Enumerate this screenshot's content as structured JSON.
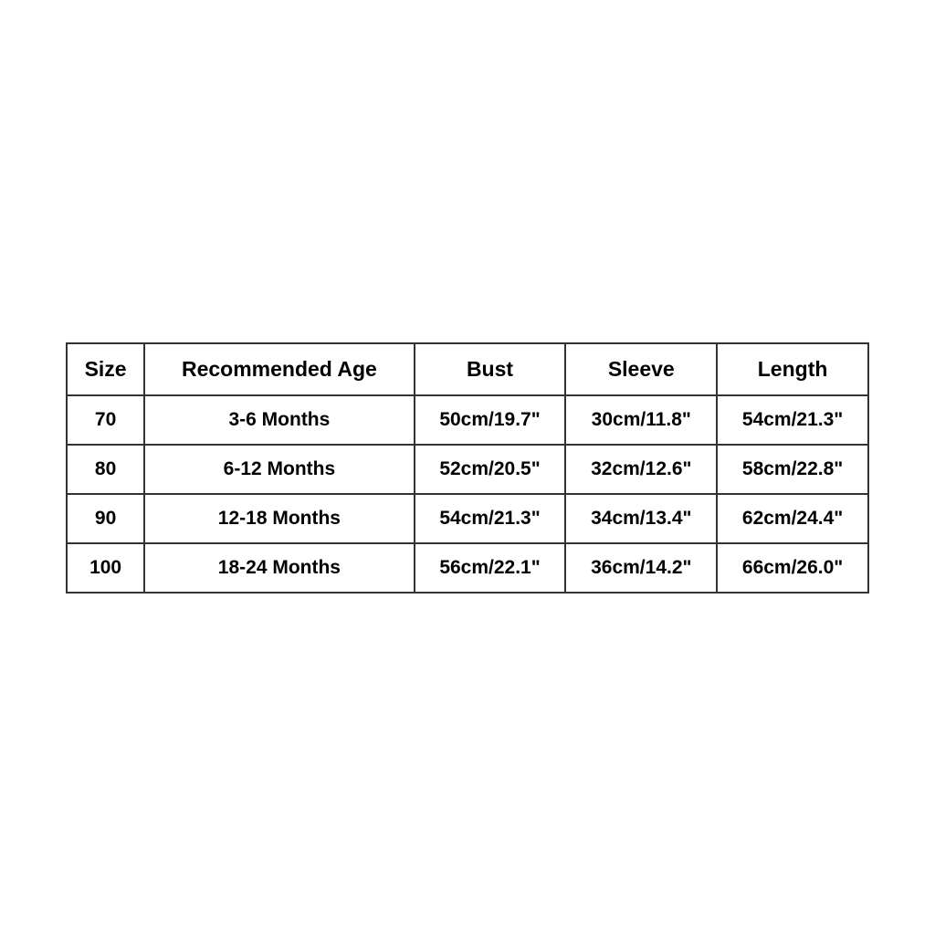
{
  "table": {
    "headers": [
      "Size",
      "Recommended Age",
      "Bust",
      "Sleeve",
      "Length"
    ],
    "rows": [
      {
        "size": "70",
        "age": "3-6 Months",
        "bust": "50cm/19.7\"",
        "sleeve": "30cm/11.8\"",
        "length": "54cm/21.3\""
      },
      {
        "size": "80",
        "age": "6-12 Months",
        "bust": "52cm/20.5\"",
        "sleeve": "32cm/12.6\"",
        "length": "58cm/22.8\""
      },
      {
        "size": "90",
        "age": "12-18 Months",
        "bust": "54cm/21.3\"",
        "sleeve": "34cm/13.4\"",
        "length": "62cm/24.4\""
      },
      {
        "size": "100",
        "age": "18-24 Months",
        "bust": "56cm/22.1\"",
        "sleeve": "36cm/14.2\"",
        "length": "66cm/26.0\""
      }
    ]
  }
}
